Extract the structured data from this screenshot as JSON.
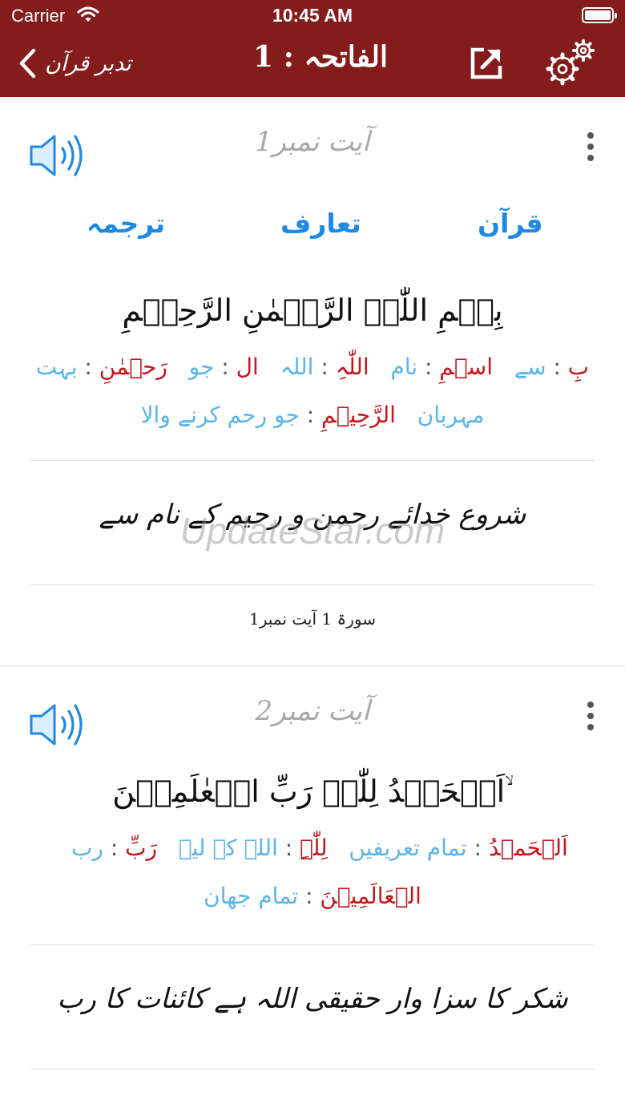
{
  "status": {
    "carrier": "Carrier",
    "time": "10:45 AM"
  },
  "nav": {
    "back_label": "تدبر قرآن",
    "title": "الفاتحہ : 1"
  },
  "colors": {
    "nav_bg": "#851c1c",
    "tab_blue": "#1e88e5",
    "arabic_red": "#c4161c",
    "urdu_blue": "#5bb5e8"
  },
  "tabs": {
    "quran": "قرآن",
    "taaruf": "تعارف",
    "tarjuma": "ترجمہ"
  },
  "verses": [
    {
      "number_label": "آیت نمبر1",
      "arabic": "بِسۡمِ اللّٰہِ الرَّحۡمٰنِ الرَّحِیۡمِ",
      "words": [
        {
          "ar": "بِ",
          "ur": "سے"
        },
        {
          "ar": "اسۡمِ",
          "ur": "نام"
        },
        {
          "ar": "اللّٰہِ",
          "ur": "اللہ"
        },
        {
          "ar": "ال",
          "ur": "جو"
        },
        {
          "ar": "رَحۡمٰنِ",
          "ur": "بہت مہربان"
        },
        {
          "ar": "الرَّحِیۡمِ",
          "ur": "جو رحم کرنے والا"
        }
      ],
      "translation": "شروع خدائے رحمن و رحیم کے نام سے",
      "reference": "سورۃ 1 آیت نمبر1"
    },
    {
      "number_label": "آیت نمبر2",
      "arabic": "اَلۡحَمۡدُ لِلّٰہِ رَبِّ الۡعٰلَمِیۡنَ ۙ",
      "words": [
        {
          "ar": "اَلۡحَمۡدُ",
          "ur": "تمام تعریفیں"
        },
        {
          "ar": "لِلّٰہِ",
          "ur": "اللہ کے لیے"
        },
        {
          "ar": "رَبِّ",
          "ur": "رب"
        },
        {
          "ar": "الۡعَالَمِیۡنَ",
          "ur": "تمام جھان"
        }
      ],
      "translation": "شکر کا سزا وار حقیقی اللہ ہے کائنات کا رب"
    }
  ],
  "watermark": "UpdateStar.com"
}
